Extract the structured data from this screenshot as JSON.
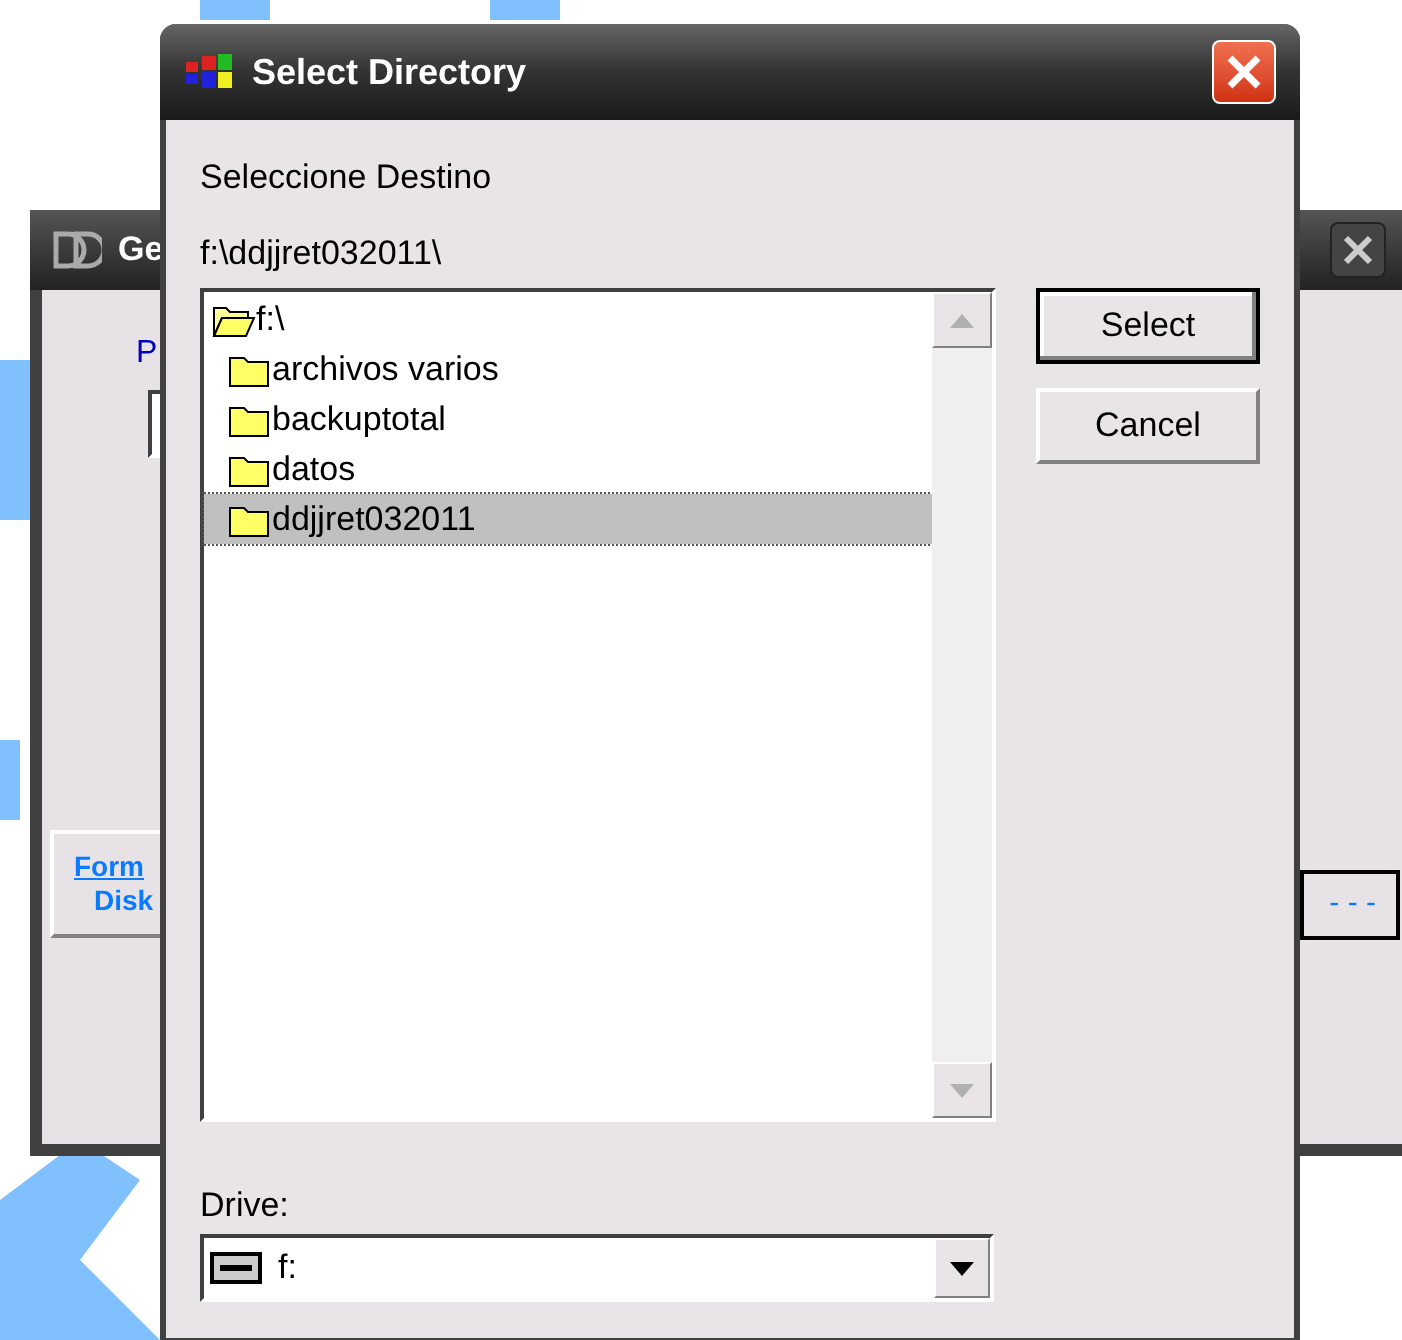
{
  "back_window": {
    "title": "Ge",
    "field_label": "P",
    "side_button": {
      "lines": [
        "Form",
        "Disk"
      ]
    },
    "browse_button": {
      "label": "- - -"
    }
  },
  "dialog": {
    "title": "Select Directory",
    "prompt": "Seleccione Destino",
    "path": "f:\\ddjjret032011\\",
    "tree": [
      {
        "label": "f:\\",
        "expanded": true,
        "selected": false,
        "children": [
          {
            "label": "archivos varios",
            "expanded": false,
            "selected": false
          },
          {
            "label": "backuptotal",
            "expanded": false,
            "selected": false
          },
          {
            "label": "datos",
            "expanded": false,
            "selected": false
          },
          {
            "label": "ddjjret032011",
            "expanded": false,
            "selected": true
          }
        ]
      }
    ],
    "buttons": [
      {
        "label": "Select",
        "default": true
      },
      {
        "label": "Cancel",
        "default": false
      }
    ],
    "drive": {
      "label": "Drive:",
      "value": "f:"
    }
  }
}
